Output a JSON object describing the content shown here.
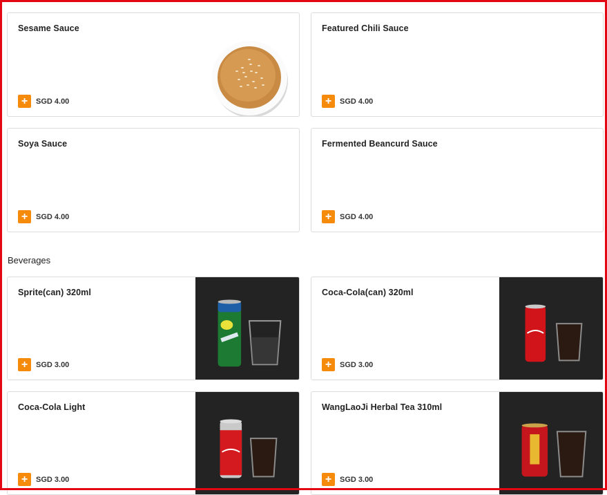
{
  "sauces": [
    {
      "name": "Sesame Sauce",
      "price": "SGD 4.00"
    },
    {
      "name": "Featured Chili Sauce",
      "price": "SGD 4.00"
    },
    {
      "name": "Soya Sauce",
      "price": "SGD 4.00"
    },
    {
      "name": "Fermented Beancurd Sauce",
      "price": "SGD 4.00"
    }
  ],
  "beverages_title": "Beverages",
  "beverages": [
    {
      "name": "Sprite(can) 320ml",
      "price": "SGD 3.00"
    },
    {
      "name": "Coca-Cola(can) 320ml",
      "price": "SGD 3.00"
    },
    {
      "name": "Coca-Cola Light",
      "price": "SGD 3.00"
    },
    {
      "name": "WangLaoJi Herbal Tea 310ml",
      "price": "SGD 3.00"
    }
  ],
  "add_symbol": "+",
  "colors": {
    "accent": "#f58a0b",
    "frame": "#e30613",
    "photo_bg": "#232323"
  }
}
